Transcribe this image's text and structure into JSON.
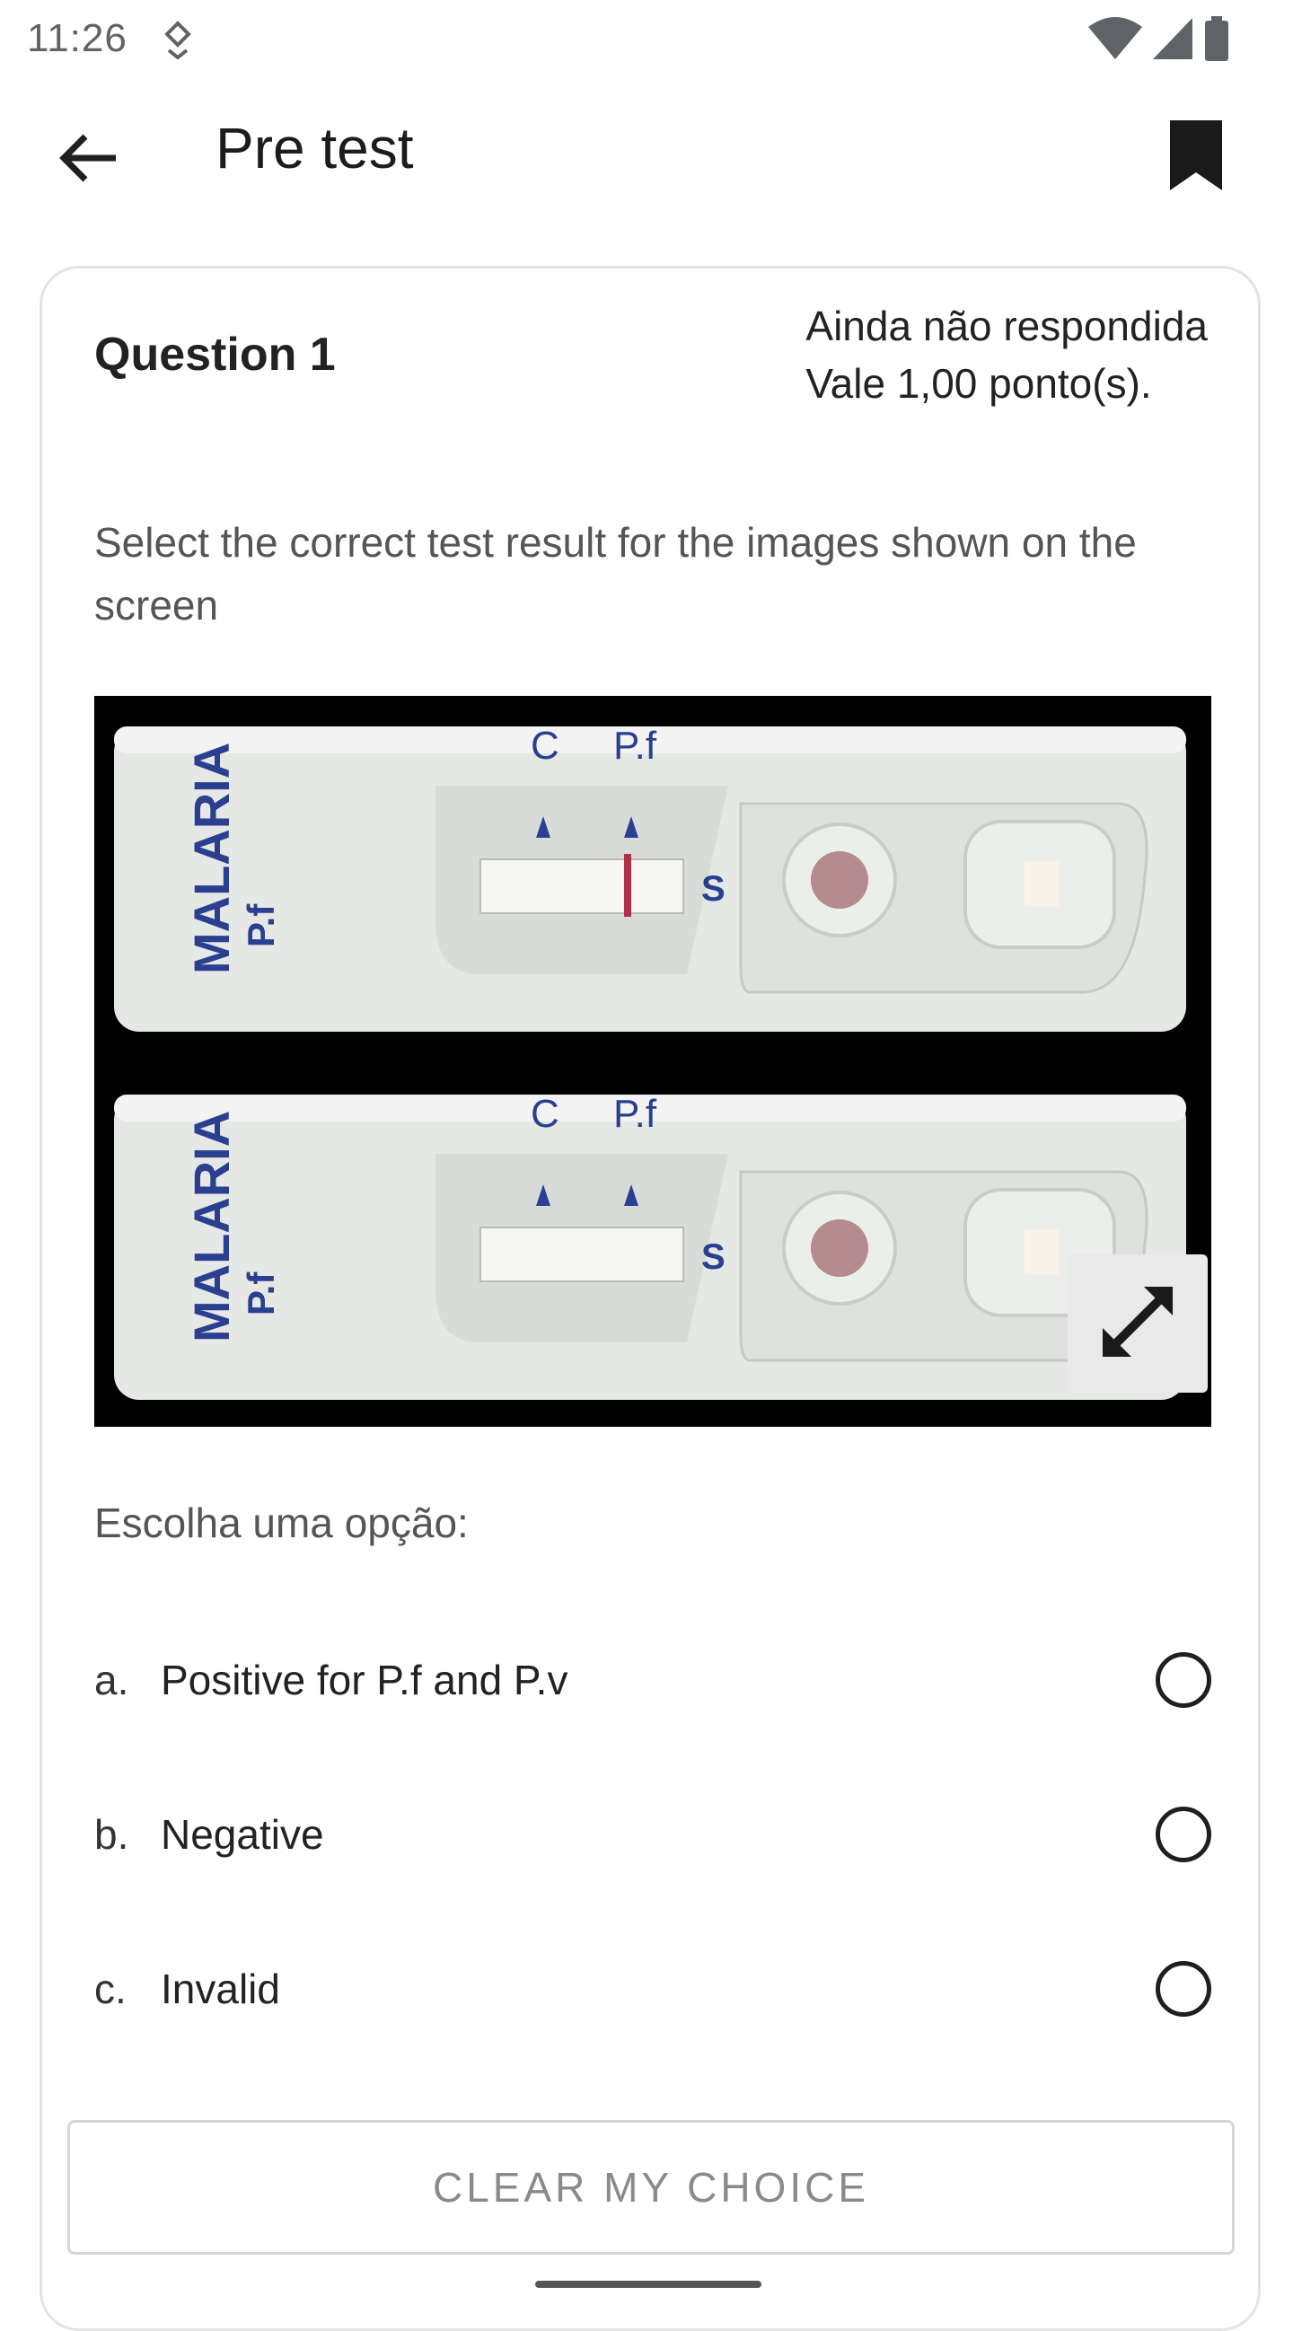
{
  "status_bar": {
    "time": "11:26",
    "icons": [
      "download-icon",
      "wifi-icon",
      "signal-icon",
      "battery-icon"
    ]
  },
  "app_bar": {
    "title": "Pre test",
    "back_icon": "arrow-left-icon",
    "bookmark_icon": "bookmark-icon"
  },
  "question": {
    "number_label": "Question 1",
    "status_line1": "Ainda não respondida",
    "status_line2": "Vale 1,00 ponto(s).",
    "text": "Select the correct test result for the images shown on the screen",
    "image_labels": {
      "brand": "MALARIA",
      "sub": "P.f",
      "c": "C",
      "pf": "P.f",
      "s": "S"
    },
    "choose_label": "Escolha uma opção:",
    "options": [
      {
        "letter": "a.",
        "label": "Positive for P.f and P.v"
      },
      {
        "letter": "b.",
        "label": "Negative"
      },
      {
        "letter": "c.",
        "label": "Invalid"
      }
    ],
    "clear_label": "CLEAR MY CHOICE"
  },
  "colors": {
    "accent_text": "#1c1c1c",
    "muted_text": "#555555",
    "image_bg": "#000000",
    "test_line": "#b0304a",
    "cassette_blue": "#2a3f8f"
  }
}
